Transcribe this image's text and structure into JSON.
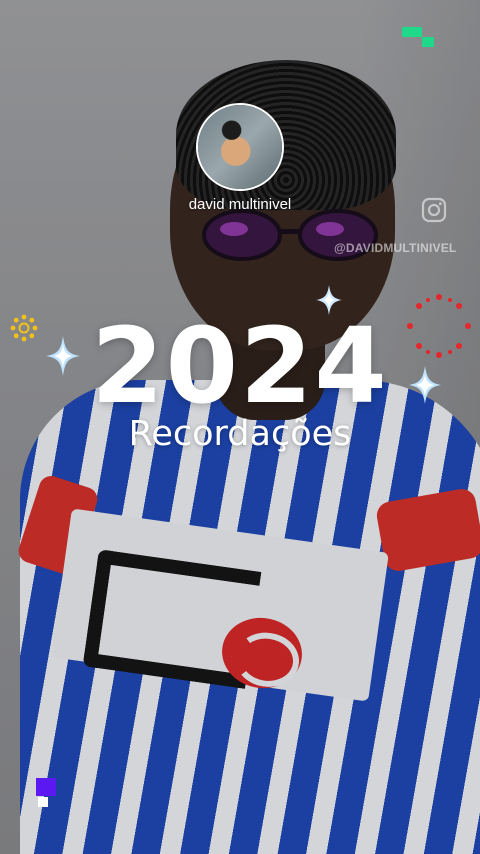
{
  "story": {
    "username": "david multinivel",
    "watermark_handle": "@DAVIDMULTINIVEL",
    "year": "2024",
    "subtitle": "Recordações"
  },
  "icons": {
    "watermark": "instagram-icon",
    "decorations": [
      "sparkle-icon",
      "sun-icon",
      "firework-icon",
      "pixel-blocks-icon"
    ]
  },
  "colors": {
    "text": "#ffffff",
    "pixel_green": "#1ed98a",
    "pixel_purple": "#5b18f0",
    "sun_yellow": "#f2c21b",
    "firework_red": "#e5262b"
  }
}
